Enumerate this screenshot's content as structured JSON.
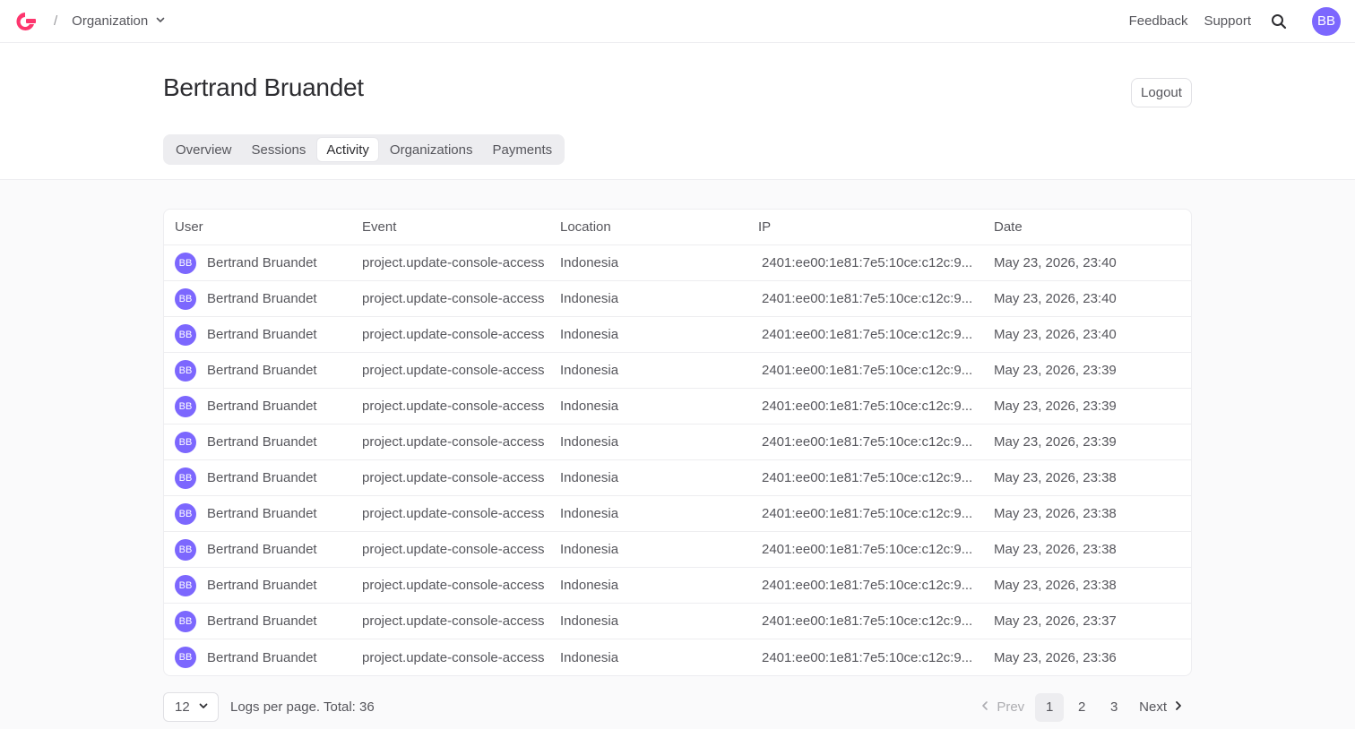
{
  "topbar": {
    "crumb_separator": "/",
    "organization_label": "Organization",
    "feedback_label": "Feedback",
    "support_label": "Support",
    "avatar_initials": "BB"
  },
  "header": {
    "user_name": "Bertrand Bruandet",
    "logout_label": "Logout",
    "tabs": [
      {
        "label": "Overview"
      },
      {
        "label": "Sessions"
      },
      {
        "label": "Activity"
      },
      {
        "label": "Organizations"
      },
      {
        "label": "Payments"
      }
    ],
    "active_tab": "Activity"
  },
  "table": {
    "columns": [
      "User",
      "Event",
      "Location",
      "IP",
      "Date"
    ],
    "rows": [
      {
        "initials": "BB",
        "user": "Bertrand Bruandet",
        "event": "project.update-console-access",
        "location": "Indonesia",
        "ip": "2401:ee00:1e81:7e5:10ce:c12c:9...",
        "date": "May 23, 2026, 23:40"
      },
      {
        "initials": "BB",
        "user": "Bertrand Bruandet",
        "event": "project.update-console-access",
        "location": "Indonesia",
        "ip": "2401:ee00:1e81:7e5:10ce:c12c:9...",
        "date": "May 23, 2026, 23:40"
      },
      {
        "initials": "BB",
        "user": "Bertrand Bruandet",
        "event": "project.update-console-access",
        "location": "Indonesia",
        "ip": "2401:ee00:1e81:7e5:10ce:c12c:9...",
        "date": "May 23, 2026, 23:40"
      },
      {
        "initials": "BB",
        "user": "Bertrand Bruandet",
        "event": "project.update-console-access",
        "location": "Indonesia",
        "ip": "2401:ee00:1e81:7e5:10ce:c12c:9...",
        "date": "May 23, 2026, 23:39"
      },
      {
        "initials": "BB",
        "user": "Bertrand Bruandet",
        "event": "project.update-console-access",
        "location": "Indonesia",
        "ip": "2401:ee00:1e81:7e5:10ce:c12c:9...",
        "date": "May 23, 2026, 23:39"
      },
      {
        "initials": "BB",
        "user": "Bertrand Bruandet",
        "event": "project.update-console-access",
        "location": "Indonesia",
        "ip": "2401:ee00:1e81:7e5:10ce:c12c:9...",
        "date": "May 23, 2026, 23:39"
      },
      {
        "initials": "BB",
        "user": "Bertrand Bruandet",
        "event": "project.update-console-access",
        "location": "Indonesia",
        "ip": "2401:ee00:1e81:7e5:10ce:c12c:9...",
        "date": "May 23, 2026, 23:38"
      },
      {
        "initials": "BB",
        "user": "Bertrand Bruandet",
        "event": "project.update-console-access",
        "location": "Indonesia",
        "ip": "2401:ee00:1e81:7e5:10ce:c12c:9...",
        "date": "May 23, 2026, 23:38"
      },
      {
        "initials": "BB",
        "user": "Bertrand Bruandet",
        "event": "project.update-console-access",
        "location": "Indonesia",
        "ip": "2401:ee00:1e81:7e5:10ce:c12c:9...",
        "date": "May 23, 2026, 23:38"
      },
      {
        "initials": "BB",
        "user": "Bertrand Bruandet",
        "event": "project.update-console-access",
        "location": "Indonesia",
        "ip": "2401:ee00:1e81:7e5:10ce:c12c:9...",
        "date": "May 23, 2026, 23:38"
      },
      {
        "initials": "BB",
        "user": "Bertrand Bruandet",
        "event": "project.update-console-access",
        "location": "Indonesia",
        "ip": "2401:ee00:1e81:7e5:10ce:c12c:9...",
        "date": "May 23, 2026, 23:37"
      },
      {
        "initials": "BB",
        "user": "Bertrand Bruandet",
        "event": "project.update-console-access",
        "location": "Indonesia",
        "ip": "2401:ee00:1e81:7e5:10ce:c12c:9...",
        "date": "May 23, 2026, 23:36"
      }
    ]
  },
  "footer": {
    "per_page_value": "12",
    "total_text": "Logs per page. Total: 36",
    "prev_label": "Prev",
    "next_label": "Next",
    "pages": [
      "1",
      "2",
      "3"
    ],
    "current_page": "1"
  },
  "colors": {
    "accent": "#7c67fe",
    "brand": "#fd366e"
  },
  "icons": {
    "logo": "appwrite-logo-icon",
    "org_dropdown": "chevron-down-icon",
    "search": "search-icon",
    "prev": "chevron-left-icon",
    "next": "chevron-right-icon"
  }
}
